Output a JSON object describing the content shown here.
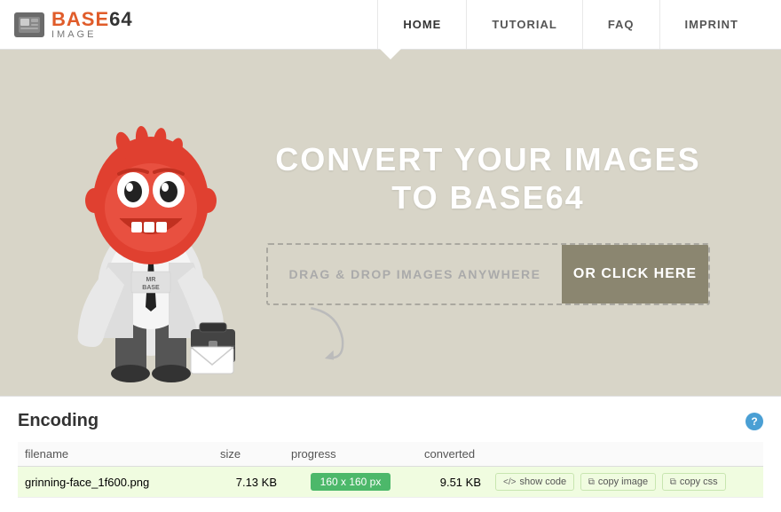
{
  "header": {
    "logo_main": "BASE64",
    "logo_highlight": "64",
    "logo_sub": "IMAGE",
    "logo_icon_text": "▣",
    "nav": [
      {
        "id": "home",
        "label": "HOME",
        "active": true
      },
      {
        "id": "tutorial",
        "label": "TUTORIAL",
        "active": false
      },
      {
        "id": "faq",
        "label": "FAQ",
        "active": false
      },
      {
        "id": "imprint",
        "label": "IMPRINT",
        "active": false
      }
    ]
  },
  "hero": {
    "title_line1": "CONVERT YOUR IMAGES",
    "title_line2": "TO BASE64",
    "drop_text": "DRAG & DROP IMAGES ANYWHERE",
    "click_label": "OR CLICK HERE"
  },
  "encoding": {
    "title": "Encoding",
    "help_label": "?",
    "table": {
      "headers": [
        "filename",
        "size",
        "progress",
        "converted",
        ""
      ],
      "rows": [
        {
          "filename": "grinning-face_1f600.png",
          "size": "7.13 KB",
          "progress": "160 x 160 px",
          "converted": "9.51 KB",
          "actions": [
            {
              "id": "show-code",
              "icon": "</>",
              "label": "show code"
            },
            {
              "id": "copy-image",
              "icon": "⧉",
              "label": "copy image"
            },
            {
              "id": "copy-css",
              "icon": "⧉",
              "label": "copy css"
            }
          ]
        }
      ]
    }
  }
}
